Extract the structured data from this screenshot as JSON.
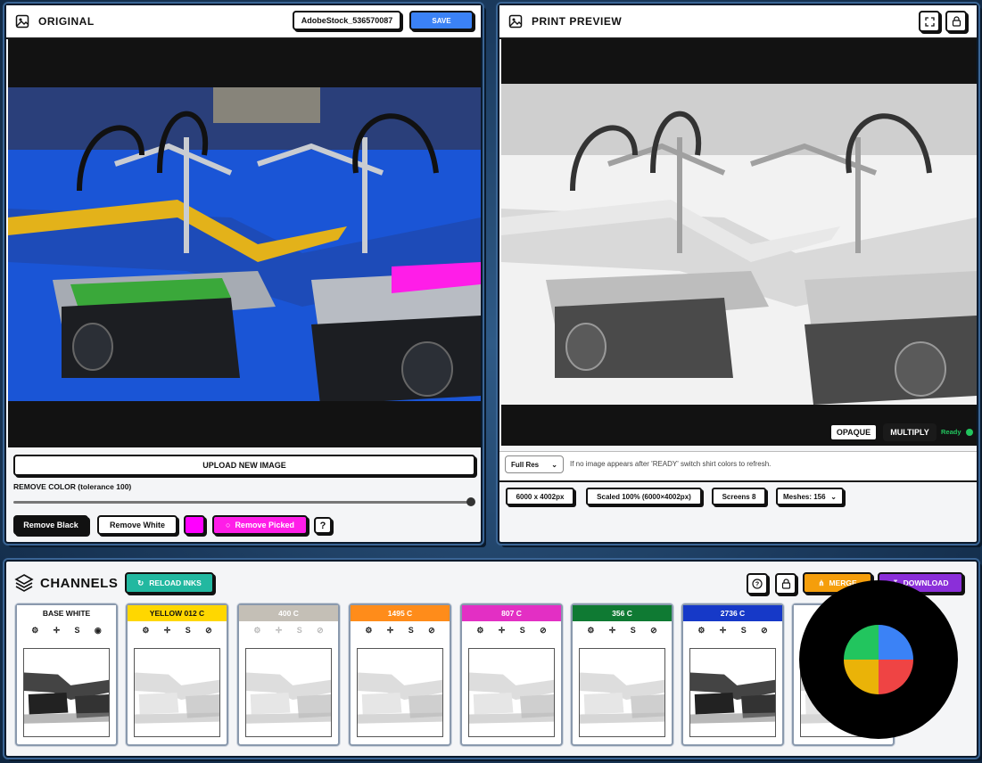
{
  "original": {
    "title": "ORIGINAL",
    "filename": "AdobeStock_536570087",
    "save": "SAVE",
    "upload": "UPLOAD NEW IMAGE",
    "remove_color_label": "REMOVE COLOR (tolerance 100)",
    "tolerance": 100,
    "remove_black": "Remove Black",
    "remove_white": "Remove White",
    "picked_color": "#ff00ff",
    "remove_picked": "Remove Picked",
    "help": "?"
  },
  "preview": {
    "title": "PRINT PREVIEW",
    "opaque": "OPAQUE",
    "multiply": "MULTIPLY",
    "status": "Ready",
    "resolution_select": "Full Res",
    "hint": "If no image appears after 'READY' switch shirt colors to refresh.",
    "size": "6000 x 4002px",
    "scaled": "Scaled 100% (6000×4002px)",
    "screens": "Screens 8",
    "meshes": "Meshes: 156"
  },
  "channels": {
    "title": "CHANNELS",
    "reload": "RELOAD INKS",
    "merge": "MERGE",
    "download": "DOWNLOAD",
    "items": [
      {
        "name": "BASE WHITE",
        "color": "#ffffff",
        "text_color": "#111111"
      },
      {
        "name": "YELLOW 012 C",
        "color": "#ffd700",
        "text_color": "#111111"
      },
      {
        "name": "400 C",
        "color": "#c4bfb6",
        "text_color": "#ffffff"
      },
      {
        "name": "1495 C",
        "color": "#ff8c1a",
        "text_color": "#ffffff"
      },
      {
        "name": "807 C",
        "color": "#e32fc4",
        "text_color": "#ffffff"
      },
      {
        "name": "356 C",
        "color": "#0f7a33",
        "text_color": "#ffffff"
      },
      {
        "name": "2736 C",
        "color": "#1639c8",
        "text_color": "#ffffff"
      },
      {
        "name": "",
        "color": "#ffffff",
        "text_color": "#111111"
      }
    ]
  },
  "icons": {
    "layers": "layers-icon",
    "image": "image-icon",
    "expand": "expand-icon",
    "lock": "lock-icon",
    "help": "help-circle-icon",
    "picker": "color-picker-icon",
    "logo": "four-color-wheel-icon"
  },
  "logo_colors": [
    "#3b82f6",
    "#22c55e",
    "#eab308",
    "#ef4444"
  ],
  "accents": {
    "save": "#3b82f6",
    "reload": "#22b8a0",
    "merge": "#f59e0b",
    "download": "#8b2fd9",
    "remove_picked": "#ff1de8",
    "ready": "#22c55e"
  }
}
